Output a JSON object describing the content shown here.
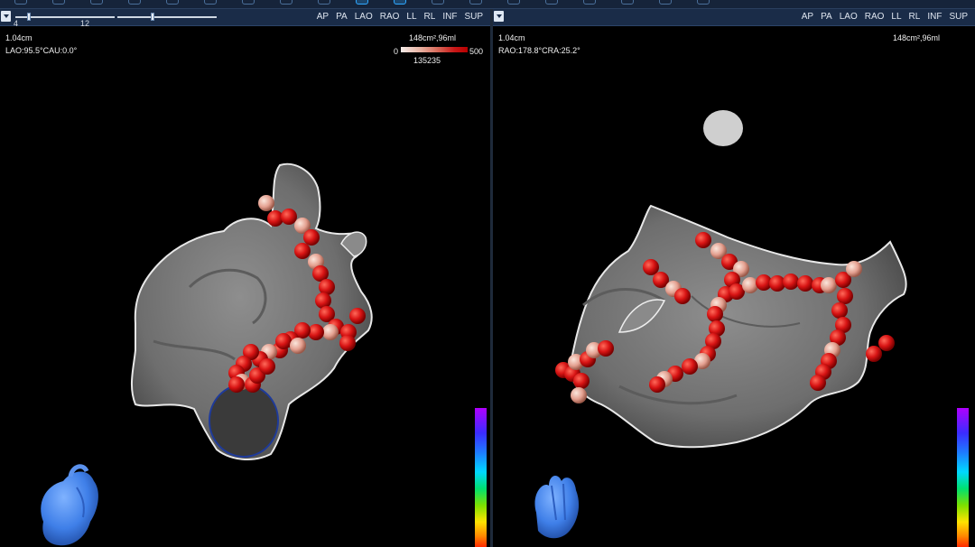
{
  "top_strip_icons": [
    "heart-icon",
    "shield-icon",
    "document-icon",
    "save-icon",
    "layers-icon",
    "map-pin-icon",
    "cursor-icon",
    "user-icon",
    "shield-icon",
    "catheter-icon",
    "catheter-icon",
    "grid-icon",
    "target-icon",
    "ruler-icon",
    "window-icon",
    "list-icon",
    "glasses-icon",
    "network-icon",
    "clock-icon"
  ],
  "views": [
    "AP",
    "PA",
    "LAO",
    "RAO",
    "LL",
    "RL",
    "INF",
    "SUP"
  ],
  "left_viewport": {
    "slider_min_label": "4",
    "slider_max_label": "12",
    "distance": "1.04cm",
    "angle": "LAO:95.5°CAU:0.0°",
    "area_volume": "148cm²,96ml",
    "scale_min": "0",
    "scale_max": "500",
    "scale_value": "135235"
  },
  "right_viewport": {
    "distance": "1.04cm",
    "angle": "RAO:178.8°CRA:25.2°",
    "area_volume": "148cm²,96ml"
  },
  "colors": {
    "toolbar_bg": "#1a2c48",
    "lesion_red": "#d81414",
    "lesion_light": "#e8b8a8",
    "heart_blue": "#3f7fe8",
    "mesh_gray": "#7a7a7a"
  }
}
